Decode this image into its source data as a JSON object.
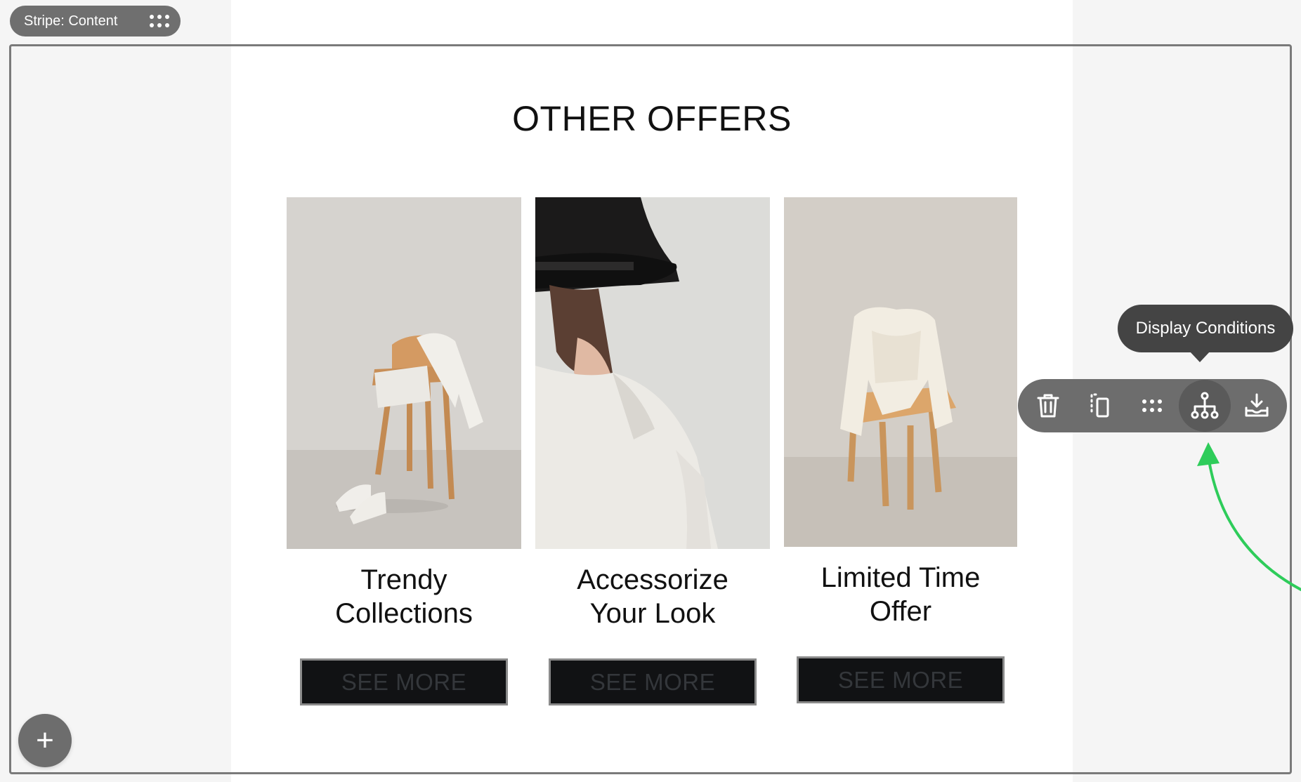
{
  "stripe": {
    "label": "Stripe: Content"
  },
  "section": {
    "title": "OTHER OFFERS"
  },
  "offers": [
    {
      "caption_line1": "Trendy",
      "caption_line2": "Collections",
      "button": "SEE MORE"
    },
    {
      "caption_line1": "Accessorize",
      "caption_line2": "Your Look",
      "button": "SEE MORE"
    },
    {
      "caption_line1": "Limited Time",
      "caption_line2": "Offer",
      "button": "SEE MORE"
    }
  ],
  "toolbar": {
    "items": [
      "trash-icon",
      "duplicate-icon",
      "drag-dots-icon",
      "sitemap-icon",
      "download-icon"
    ],
    "active": "sitemap-icon",
    "tooltip": "Display Conditions"
  },
  "add_button": {
    "label": "+"
  },
  "colors": {
    "toolbar_bg": "#6d6d6d",
    "tooltip_bg": "#444444",
    "button_bg": "#111214",
    "annotation_arrow": "#2ecc5a"
  }
}
